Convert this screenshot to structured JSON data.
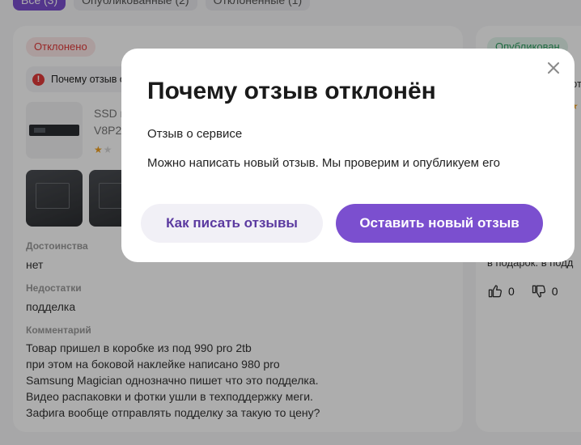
{
  "tabs": [
    {
      "label": "Все (3)",
      "active": true
    },
    {
      "label": "Опубликованные (2)",
      "active": false
    },
    {
      "label": "Отклоненные (1)",
      "active": false
    }
  ],
  "review": {
    "status": "Отклонено",
    "reason_link": "Почему отзыв отклонён",
    "product_name": "SSD накопитель Samsung\nV8P2T0BW",
    "rating": 1,
    "advantages_label": "Достоинства",
    "advantages": "нет",
    "disadvantages_label": "Недостатки",
    "disadvantages": "подделка",
    "comment_label": "Комментарий",
    "comment": "Товар пришел в коробке из под 990 pro 2tb\nпри этом на боковой наклейке написано 980 pro\nSamsung Magician однозначно пишет что это подделка.\nВидео распаковки и фотки ушли в техподдержку меги.\nЗафига вообще отправлять подделку за такую то цену?"
  },
  "right_review": {
    "status": "Опубликован",
    "partial_text_1": "рт",
    "partial_text_2": "в подарок. в подд",
    "likes": "0",
    "dislikes": "0"
  },
  "modal": {
    "title": "Почему отзыв отклонён",
    "subtitle": "Отзыв о сервисе",
    "body": "Можно написать новый отзыв. Мы проверим и опубликуем его",
    "secondary_button": "Как писать отзывы",
    "primary_button": "Оставить новый отзыв"
  },
  "colors": {
    "accent": "#7b4fcf",
    "rejected": "#e03a3a",
    "published": "#2e9e61"
  }
}
